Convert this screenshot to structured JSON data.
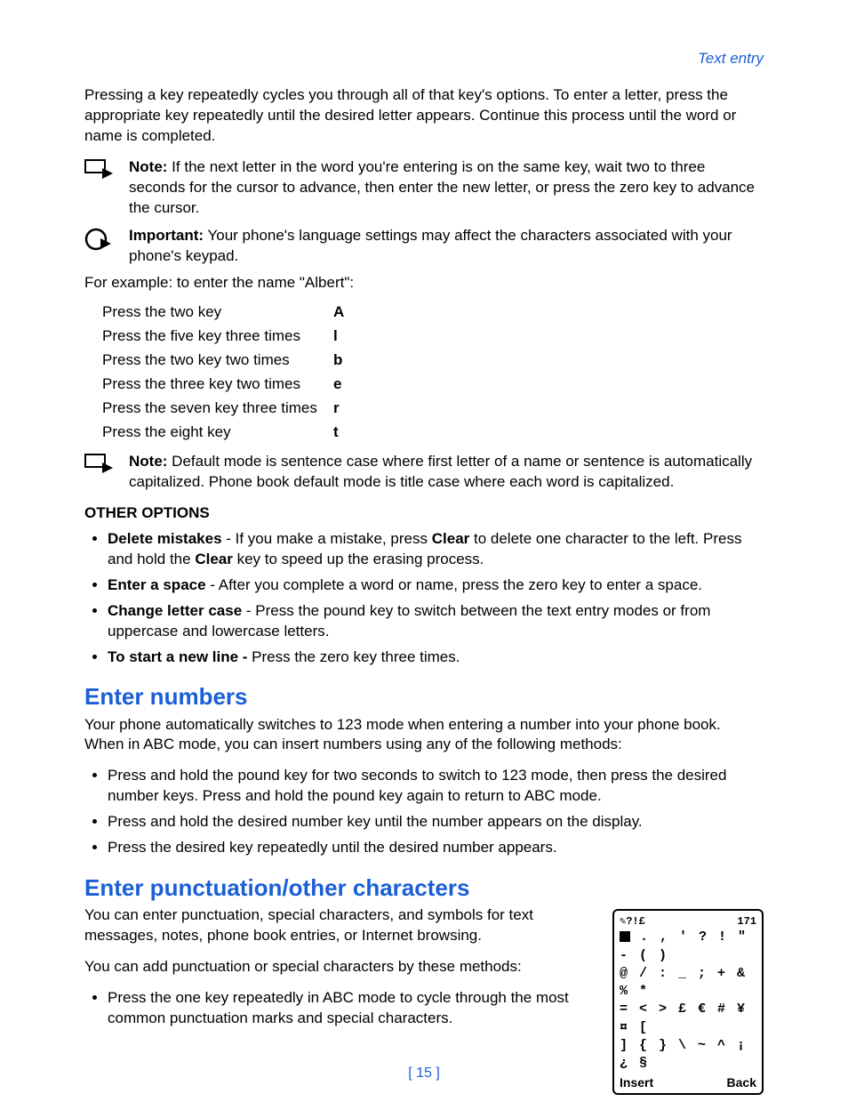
{
  "header": {
    "breadcrumb": "Text entry"
  },
  "intro": "Pressing a key repeatedly cycles you through all of that key's options. To enter a letter, press the appropriate key repeatedly until the desired letter appears. Continue this process until the word or name is completed.",
  "note1": {
    "label": "Note:",
    "text": " If the next letter in the word you're entering is on the same key, wait two to three seconds for the cursor to advance, then enter the new letter, or press the zero key to advance the cursor."
  },
  "important": {
    "label": "Important:",
    "text": " Your phone's language settings may affect the characters associated with your phone's keypad."
  },
  "example_intro": "For example: to enter the name \"Albert\":",
  "albert": [
    {
      "desc": "Press the two key",
      "letter": "A"
    },
    {
      "desc": "Press the five key three times",
      "letter": "l"
    },
    {
      "desc": "Press the two key two times",
      "letter": "b"
    },
    {
      "desc": "Press the three key two times",
      "letter": "e"
    },
    {
      "desc": "Press the seven key three times",
      "letter": "r"
    },
    {
      "desc": "Press the eight key",
      "letter": "t"
    }
  ],
  "note2": {
    "label": "Note:",
    "text": " Default mode is sentence case where first letter of a name or sentence is automatically capitalized. Phone book default mode is title case where each word is capitalized."
  },
  "other_options": {
    "heading": "OTHER OPTIONS",
    "items": [
      {
        "bold": "Delete mistakes",
        "rest_a": " - If you make a mistake, press ",
        "bold2": "Clear",
        "rest_b": " to delete one character to the left. Press and hold the ",
        "bold3": "Clear",
        "rest_c": " key to speed up the erasing process."
      },
      {
        "bold": "Enter a space",
        "rest_a": " - After you complete a word or name, press the zero key to enter a space."
      },
      {
        "bold": "Change letter case",
        "rest_a": " - Press the pound key to switch between the text entry modes or from uppercase and lowercase letters."
      },
      {
        "bold": "To start a new line -",
        "rest_a": " Press the zero key three times."
      }
    ]
  },
  "enter_numbers": {
    "heading": "Enter numbers",
    "intro": "Your phone automatically switches to 123 mode when entering a number into your phone book. When in ABC mode, you can insert numbers using any of the following methods:",
    "items": [
      "Press and hold the pound key for two seconds to switch to 123 mode, then press the desired number keys. Press and hold the pound key again to return to ABC mode.",
      "Press and hold the desired number key until the number appears on the display.",
      "Press the desired key repeatedly until the desired number appears."
    ]
  },
  "enter_punct": {
    "heading": "Enter punctuation/other characters",
    "p1": "You can enter punctuation, special characters, and symbols for text messages, notes, phone book entries, or Internet browsing.",
    "p2": "You can add punctuation or special characters by these methods:",
    "item1": "Press the one key repeatedly in ABC mode to cycle through the most common punctuation marks and special characters."
  },
  "phone": {
    "top_left": "✎?!£",
    "top_right": "171",
    "line1": ". , ' ? ! \" - ( )",
    "line2": "@ / : _ ; + & % *",
    "line3": "= < > £ € # ¥ ¤ [",
    "line4": "] { } \\ ~ ^ ¡ ¿ §",
    "insert": "Insert",
    "back": "Back"
  },
  "page_number": "[ 15 ]"
}
